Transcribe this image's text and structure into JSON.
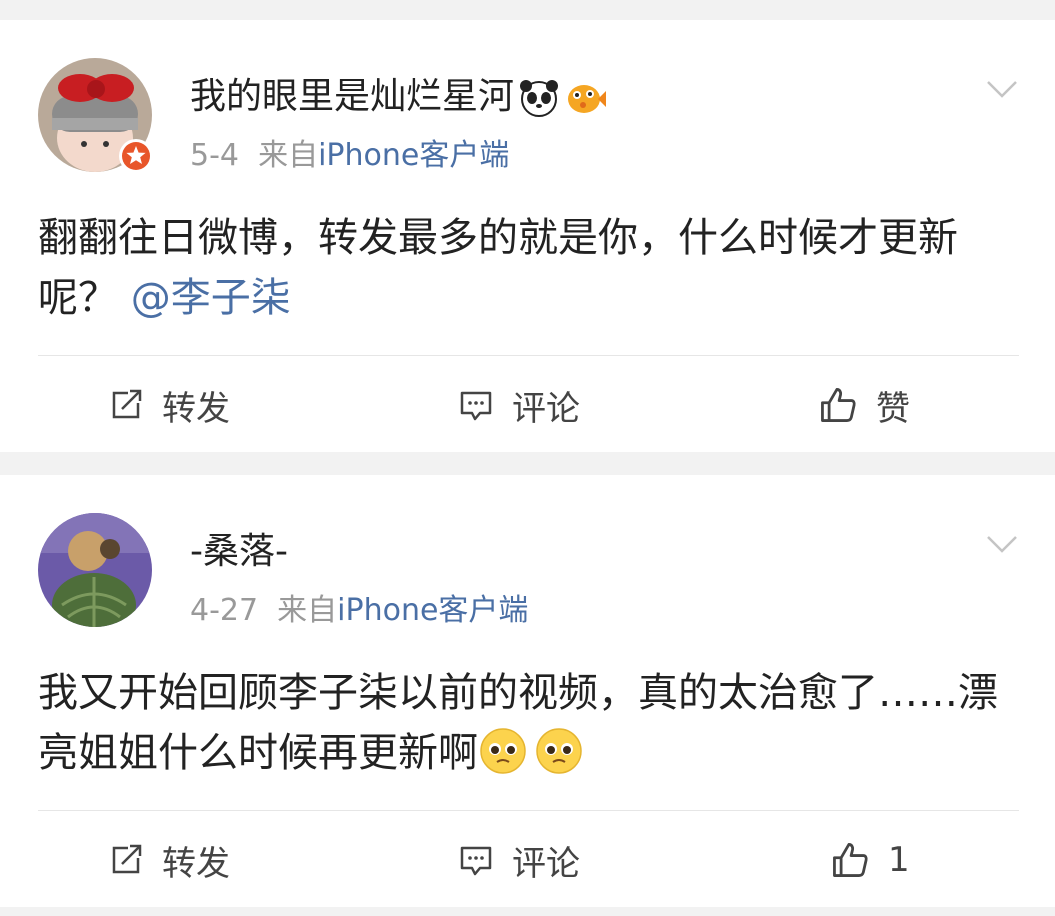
{
  "posts": [
    {
      "username": "我的眼里是灿烂星河",
      "date": "5-4",
      "from_prefix": "来自",
      "source": "iPhone客户端",
      "text": "翻翻往日微博，转发最多的就是你，什么时候才更新呢？",
      "mention": "@李子柒",
      "actions": {
        "repost": "转发",
        "comment": "评论",
        "like": "赞"
      },
      "icons": {
        "name_emoji_1": "panda-icon",
        "name_emoji_2": "pufferfish-icon",
        "badge": "star-badge-icon"
      }
    },
    {
      "username": "-桑落-",
      "date": "4-27",
      "from_prefix": "来自",
      "source": "iPhone客户端",
      "text": "我又开始回顾李子柒以前的视频，真的太治愈了……漂亮姐姐什么时候再更新啊",
      "emoji_count_note": "pleading-face-icon",
      "actions": {
        "repost": "转发",
        "comment": "评论",
        "like": "1"
      }
    }
  ]
}
